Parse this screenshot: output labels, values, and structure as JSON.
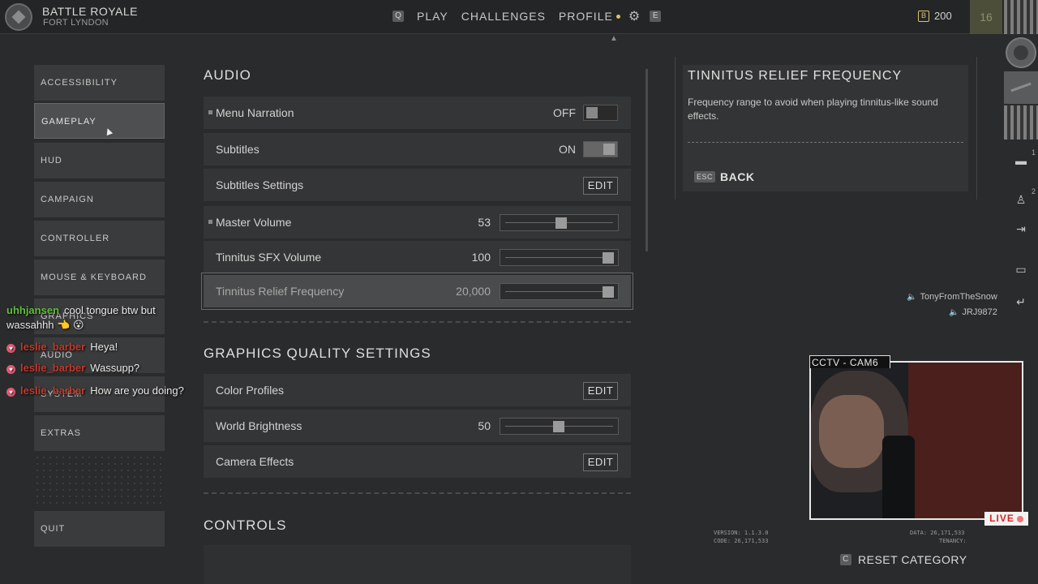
{
  "header": {
    "mode_title": "BATTLE ROYALE",
    "mode_subtitle": "FORT LYNDON",
    "nav_left_key": "Q",
    "nav_items": [
      "PLAY",
      "CHALLENGES",
      "PROFILE"
    ],
    "nav_right_key": "E",
    "currency_icon": "B",
    "currency_value": "200",
    "level": "16"
  },
  "categories": [
    {
      "label": "ACCESSIBILITY"
    },
    {
      "label": "GAMEPLAY"
    },
    {
      "label": "HUD"
    },
    {
      "label": "CAMPAIGN"
    },
    {
      "label": "CONTROLLER"
    },
    {
      "label": "MOUSE & KEYBOARD"
    },
    {
      "label": "GRAPHICS"
    },
    {
      "label": "AUDIO"
    },
    {
      "label": "SYSTEM"
    },
    {
      "label": "EXTRAS"
    }
  ],
  "active_category": "GAMEPLAY",
  "quit_label": "QUIT",
  "chat": [
    {
      "user": "uhhjansen",
      "user_color": "#5fbf3c",
      "text": "cool tongue btw but wassahhh 👈 😮",
      "heart": false
    },
    {
      "user": "leslie_barber",
      "user_color": "#c0392b",
      "text": "Heya!",
      "heart": true
    },
    {
      "user": "leslie_barber",
      "user_color": "#c0392b",
      "text": "Wassupp?",
      "heart": true
    },
    {
      "user": "leslie_barber",
      "user_color": "#c0392b",
      "text": "How are you doing?",
      "heart": true
    }
  ],
  "audio": {
    "title": "AUDIO",
    "rows": [
      {
        "label": "Menu Narration",
        "value": "OFF",
        "control": "toggle",
        "on": false,
        "marker": true
      },
      {
        "label": "Subtitles",
        "value": "ON",
        "control": "toggle",
        "on": true,
        "marker": false
      },
      {
        "label": "Subtitles Settings",
        "value": "",
        "control": "edit",
        "button": "EDIT",
        "marker": false
      },
      {
        "label": "Master Volume",
        "value": "53",
        "control": "slider",
        "level": 0.53,
        "marker": true
      },
      {
        "label": "Tinnitus SFX Volume",
        "value": "100",
        "control": "slider",
        "level": 1.0,
        "marker": false
      },
      {
        "label": "Tinnitus Relief Frequency",
        "value": "20,000",
        "control": "slider",
        "level": 1.0,
        "marker": false,
        "selected": true
      }
    ]
  },
  "graphics": {
    "title": "GRAPHICS QUALITY SETTINGS",
    "rows": [
      {
        "label": "Color Profiles",
        "control": "edit",
        "button": "EDIT"
      },
      {
        "label": "World Brightness",
        "value": "50",
        "control": "slider",
        "level": 0.5
      },
      {
        "label": "Camera Effects",
        "control": "edit",
        "button": "EDIT"
      }
    ]
  },
  "controls": {
    "title": "CONTROLS"
  },
  "info_panel": {
    "title": "TINNITUS RELIEF FREQUENCY",
    "description": "Frequency range to avoid when playing tinnitus-like sound effects.",
    "back_key": "ESC",
    "back_label": "BACK"
  },
  "party": [
    "TonyFromTheSnow",
    "JRJ9872"
  ],
  "webcam": {
    "label": "CCTV - CAM6",
    "live": "LIVE"
  },
  "version_left": [
    "VERSION: 1.1.3.0",
    "CODE: 26,171,533"
  ],
  "version_right": [
    "DATA: 26,171,533",
    "TENANCY:"
  ],
  "reset": {
    "key": "C",
    "label": "RESET CATEGORY"
  },
  "strip_badges": [
    "1",
    "2"
  ]
}
